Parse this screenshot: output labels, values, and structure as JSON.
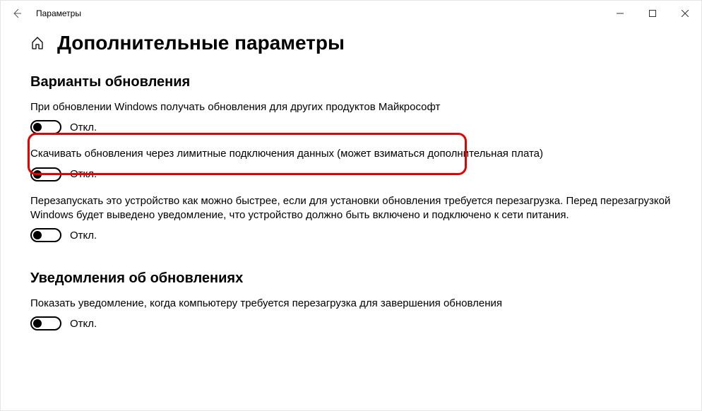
{
  "window": {
    "title": "Параметры"
  },
  "page": {
    "title": "Дополнительные параметры"
  },
  "sections": {
    "update_options": {
      "title": "Варианты обновления",
      "items": [
        {
          "label": "При обновлении Windows получать обновления для других продуктов Майкрософт",
          "state": "Откл."
        },
        {
          "label": "Скачивать обновления через лимитные подключения данных (может взиматься дополнительная плата)",
          "state": "Откл."
        },
        {
          "label": "Перезапускать это устройство как можно быстрее, если для установки обновления требуется перезагрузка. Перед перезагрузкой Windows будет выведено уведомление, что устройство должно быть включено и подключено к сети питания.",
          "state": "Откл."
        }
      ]
    },
    "notifications": {
      "title": "Уведомления об обновлениях",
      "items": [
        {
          "label": "Показать уведомление, когда компьютеру требуется перезагрузка для завершения обновления",
          "state": "Откл."
        }
      ]
    }
  }
}
